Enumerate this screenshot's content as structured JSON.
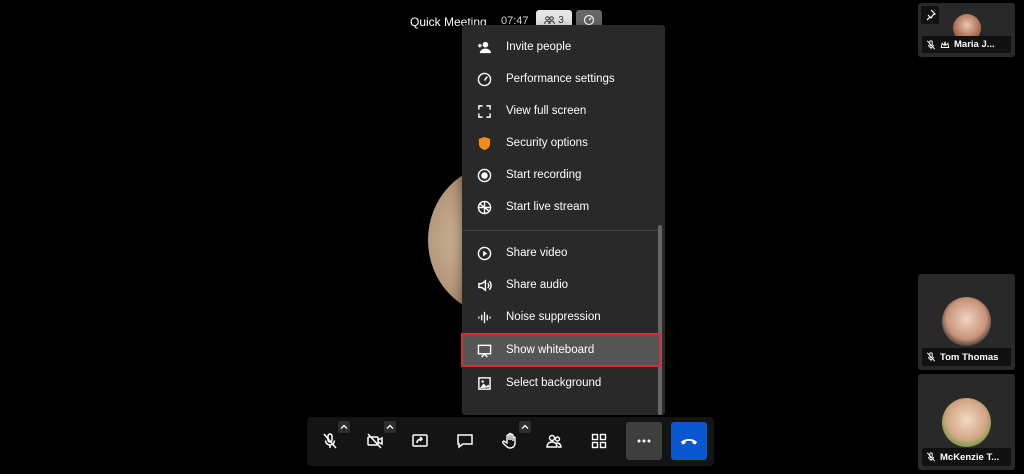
{
  "header": {
    "title": "Quick Meeting",
    "time": "07:47",
    "participant_count": "3",
    "participants_icon": "people-icon",
    "performance_icon": "gauge-icon"
  },
  "menu": {
    "items": [
      {
        "label": "Invite people",
        "icon": "invite-icon"
      },
      {
        "label": "Performance settings",
        "icon": "gauge-icon"
      },
      {
        "label": "View full screen",
        "icon": "fullscreen-icon"
      },
      {
        "label": "Security options",
        "icon": "shield-icon"
      },
      {
        "label": "Start recording",
        "icon": "record-icon"
      },
      {
        "label": "Start live stream",
        "icon": "livestream-icon"
      },
      {
        "label": "Share video",
        "icon": "play-icon"
      },
      {
        "label": "Share audio",
        "icon": "speaker-icon"
      },
      {
        "label": "Noise suppression",
        "icon": "waveform-icon"
      },
      {
        "label": "Show whiteboard",
        "icon": "whiteboard-icon"
      },
      {
        "label": "Select background",
        "icon": "image-icon"
      }
    ],
    "highlighted_item": "Show whiteboard"
  },
  "toolbar": {
    "buttons": [
      {
        "name": "microphone",
        "icon": "mic-off-icon"
      },
      {
        "name": "camera",
        "icon": "camera-off-icon"
      },
      {
        "name": "screen-share",
        "icon": "screen-share-icon"
      },
      {
        "name": "chat",
        "icon": "chat-icon"
      },
      {
        "name": "raise-hand",
        "icon": "hand-icon"
      },
      {
        "name": "participants",
        "icon": "participants-icon"
      },
      {
        "name": "tile-view",
        "icon": "grid-icon"
      },
      {
        "name": "more",
        "icon": "more-icon"
      },
      {
        "name": "hangup",
        "icon": "hangup-icon"
      }
    ]
  },
  "participants": [
    {
      "name": "Maria J...",
      "moderator": true,
      "muted": true
    },
    {
      "name": "Tom Thomas",
      "moderator": false,
      "muted": true
    },
    {
      "name": "McKenzie T...",
      "moderator": false,
      "muted": true
    }
  ],
  "colors": {
    "background": "#000000",
    "menu_bg": "#292929",
    "highlight_border": "#d42f36",
    "hangup": "#0b57d0",
    "shield": "#f28c1a"
  }
}
